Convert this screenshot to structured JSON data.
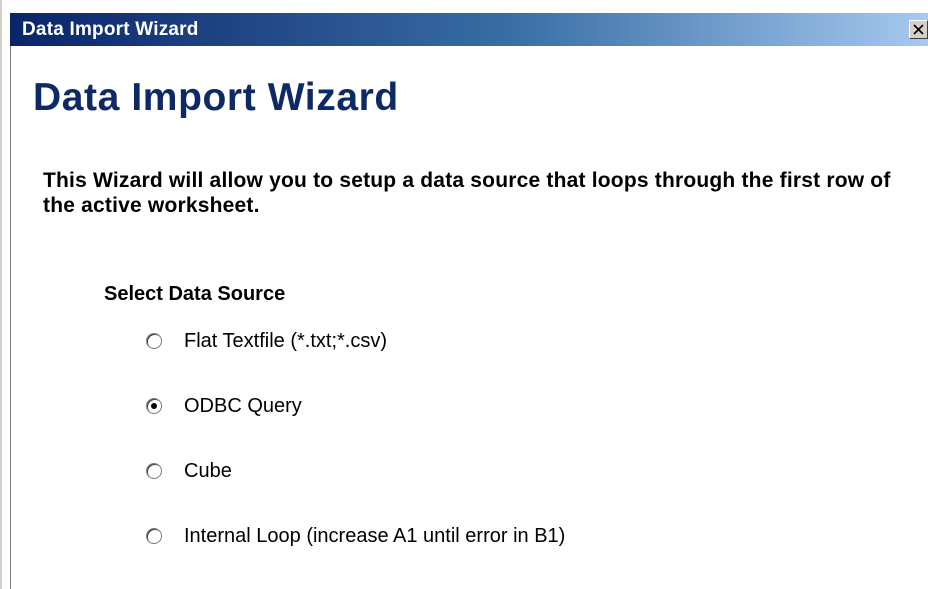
{
  "window": {
    "title": "Data Import Wizard"
  },
  "content": {
    "heading": "Data Import Wizard",
    "description": "This Wizard will allow you to setup a data source that loops through the first row of the active worksheet.",
    "section_label": "Select Data Source"
  },
  "data_source_options": [
    {
      "label": "Flat Textfile (*.txt;*.csv)",
      "selected": false
    },
    {
      "label": "ODBC Query",
      "selected": true
    },
    {
      "label": "Cube",
      "selected": false
    },
    {
      "label": "Internal Loop (increase A1 until error in B1)",
      "selected": false
    }
  ],
  "colors": {
    "titlebar_start": "#0a246a",
    "titlebar_end": "#a6caf0",
    "heading": "#0e2a66"
  },
  "icons": {
    "close": "close-icon"
  }
}
